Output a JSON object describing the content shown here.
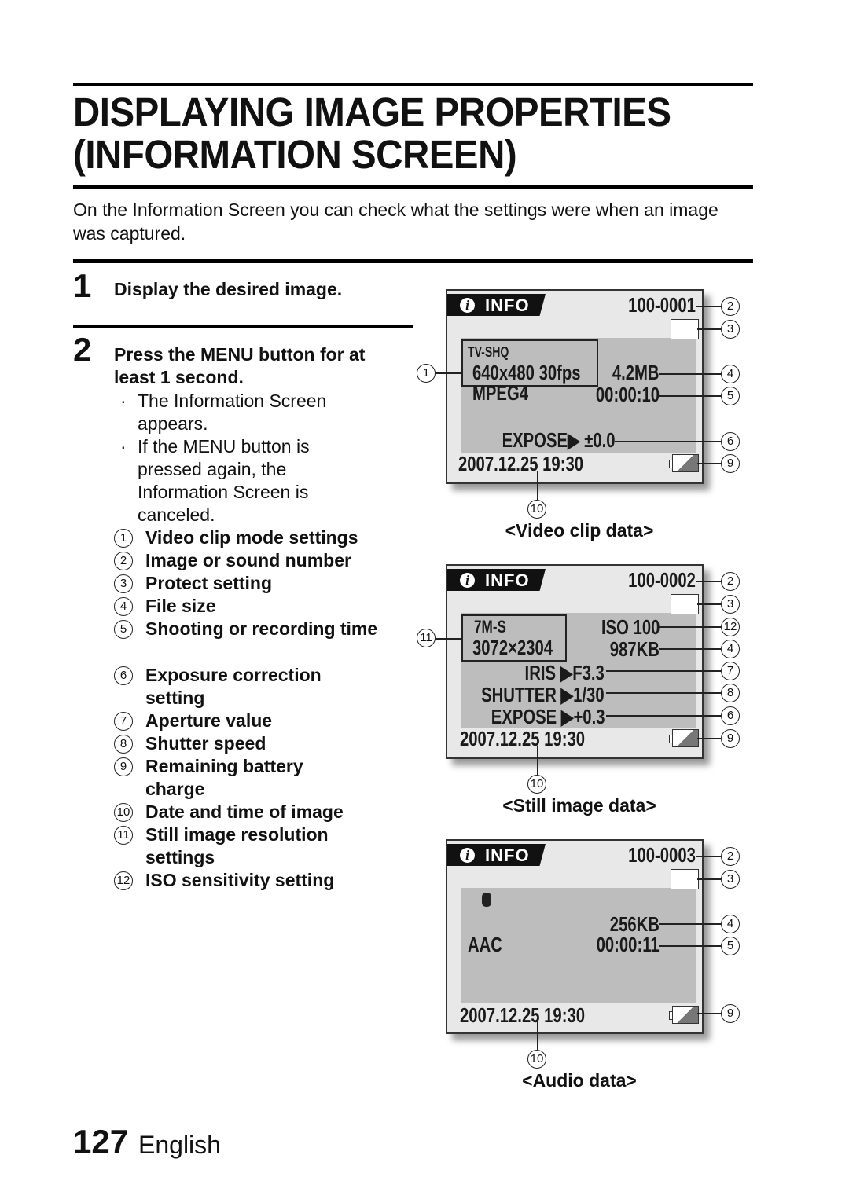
{
  "page": {
    "title_line1": "DISPLAYING IMAGE PROPERTIES",
    "title_line2": "(INFORMATION SCREEN)",
    "intro": "On the Information Screen you can check what the settings were when an image was captured.",
    "page_number": "127",
    "language": "English"
  },
  "steps": [
    {
      "number": "1",
      "text": "Display the desired image."
    },
    {
      "number": "2",
      "text": "Press the MENU button for at least 1 second.",
      "bullets": [
        "The Information Screen appears.",
        "If the MENU button is pressed again, the Information Screen is canceled."
      ]
    }
  ],
  "legend": [
    {
      "num": "1",
      "label": "Video clip mode settings"
    },
    {
      "num": "2",
      "label": "Image or sound number"
    },
    {
      "num": "3",
      "label": "Protect setting"
    },
    {
      "num": "4",
      "label": "File size"
    },
    {
      "num": "5",
      "label": "Shooting or recording time"
    },
    {
      "num": "6",
      "label": "Exposure correction setting"
    },
    {
      "num": "7",
      "label": "Aperture value"
    },
    {
      "num": "8",
      "label": "Shutter speed"
    },
    {
      "num": "9",
      "label": "Remaining battery charge"
    },
    {
      "num": "10",
      "label": "Date and time of image"
    },
    {
      "num": "11",
      "label": "Still image resolution settings"
    },
    {
      "num": "12",
      "label": "ISO sensitivity setting"
    }
  ],
  "screens": {
    "video": {
      "caption": "<Video clip data>",
      "info_label": "INFO",
      "file_number": "100-0001",
      "mode": "TV-SHQ",
      "resolution": "640x480 30fps",
      "codec": "MPEG4",
      "file_size": "4.2MB",
      "time": "00:00:10",
      "expose": "EXPOSE▶ ±0.0",
      "datetime": "2007.12.25 19:30"
    },
    "still": {
      "caption": "<Still image data>",
      "info_label": "INFO",
      "file_number": "100-0002",
      "mode": "7M-S",
      "resolution": "3072×2304",
      "iso": "ISO 100",
      "file_size": "987KB",
      "iris": "IRIS ▶F3.3",
      "shutter": "SHUTTER ▶1/30",
      "expose": "EXPOSE ▶+0.3",
      "datetime": "2007.12.25 19:30"
    },
    "audio": {
      "caption": "<Audio data>",
      "info_label": "INFO",
      "file_number": "100-0003",
      "mic_icon": "🎙",
      "file_size": "256KB",
      "codec": "AAC",
      "time": "00:00:11",
      "datetime": "2007.12.25 19:30"
    }
  },
  "callouts": {
    "c1": "1",
    "c2": "2",
    "c3": "3",
    "c4": "4",
    "c5": "5",
    "c6": "6",
    "c7": "7",
    "c8": "8",
    "c9": "9",
    "c10": "10",
    "c11": "11",
    "c12": "12"
  }
}
